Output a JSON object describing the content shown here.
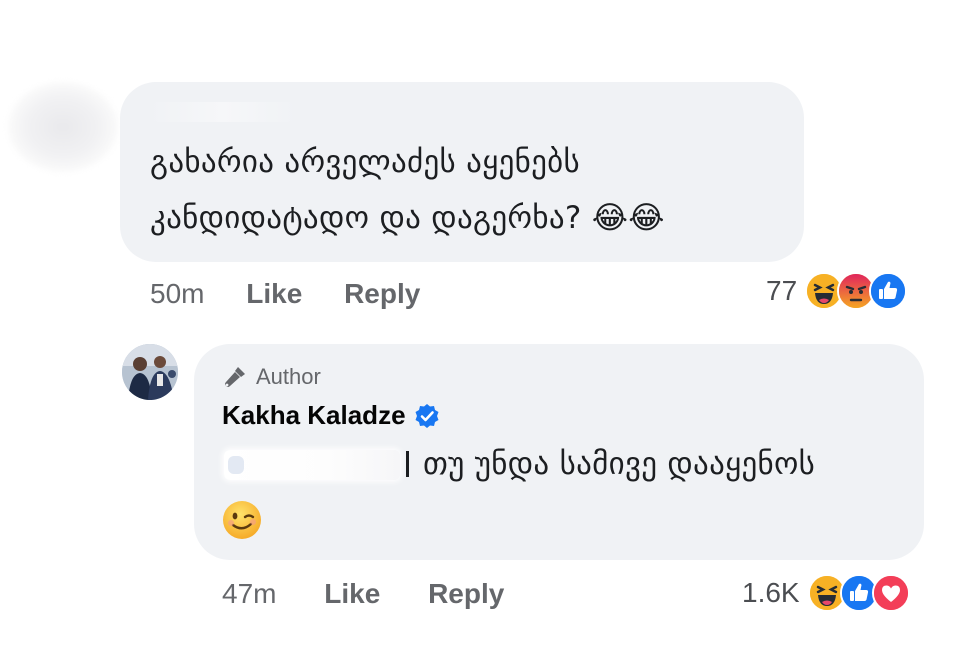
{
  "comment": {
    "text": "გახარია არველაძეს აყენებს კანდიდატადო და დაგერხა? 😂😂",
    "emoji_names": [
      "tears-of-joy-icon",
      "tears-of-joy-icon"
    ],
    "time": "50m",
    "like_label": "Like",
    "reply_label": "Reply",
    "reaction_count": "77",
    "reaction_icons": [
      "haha-icon",
      "angry-icon",
      "like-icon"
    ]
  },
  "reply": {
    "author_badge": "Author",
    "author_name": "Kakha Kaladze",
    "verified": true,
    "text": "თუ უნდა სამივე დააყენოს",
    "trailing_emoji": "wink-icon",
    "time": "47m",
    "like_label": "Like",
    "reply_label": "Reply",
    "reaction_count": "1.6K",
    "reaction_icons": [
      "haha-icon",
      "like-icon",
      "love-icon"
    ]
  },
  "colors": {
    "bubble": "#f0f2f5",
    "meta_text": "#65676b",
    "like_blue": "#1877f2",
    "love_red": "#f33e58",
    "angry_orange": "#e9710f",
    "haha_yellow": "#f7b125"
  }
}
